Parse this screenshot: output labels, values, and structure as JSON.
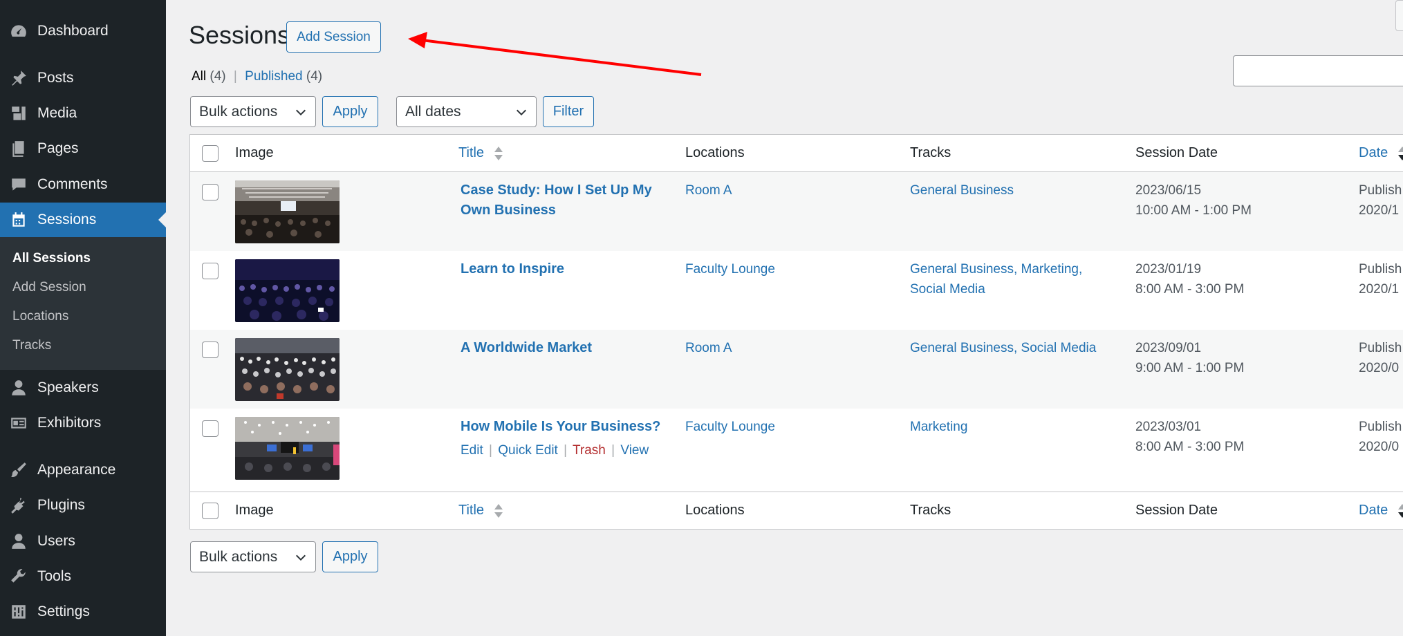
{
  "colors": {
    "sidebar_bg": "#1d2327",
    "accent": "#2271b1",
    "arrow": "#ff0000",
    "trash": "#b32d2e"
  },
  "sidebar": {
    "items": [
      {
        "label": "Dashboard",
        "icon": "dashboard-icon"
      },
      {
        "label": "Posts",
        "icon": "pushpin-icon"
      },
      {
        "label": "Media",
        "icon": "media-icon"
      },
      {
        "label": "Pages",
        "icon": "pages-icon"
      },
      {
        "label": "Comments",
        "icon": "comment-icon"
      },
      {
        "label": "Sessions",
        "icon": "calendar-icon",
        "current": true
      },
      {
        "label": "Speakers",
        "icon": "user-icon"
      },
      {
        "label": "Exhibitors",
        "icon": "id-card-icon"
      },
      {
        "label": "Appearance",
        "icon": "brush-icon"
      },
      {
        "label": "Plugins",
        "icon": "plug-icon"
      },
      {
        "label": "Users",
        "icon": "user-icon"
      },
      {
        "label": "Tools",
        "icon": "wrench-icon"
      },
      {
        "label": "Settings",
        "icon": "sliders-icon"
      }
    ],
    "submenu": [
      "All Sessions",
      "Add Session",
      "Locations",
      "Tracks"
    ]
  },
  "header": {
    "title": "Sessions",
    "add_button": "Add Session"
  },
  "views": {
    "all_label": "All",
    "all_count": "(4)",
    "separator": "|",
    "published_label": "Published",
    "published_count": "(4)"
  },
  "toolbar": {
    "bulk_actions": "Bulk actions",
    "apply": "Apply",
    "dates": "All dates",
    "filter": "Filter"
  },
  "table": {
    "columns": [
      "Image",
      "Title",
      "Locations",
      "Tracks",
      "Session Date",
      "Date"
    ],
    "rows": [
      {
        "title_line1": "Case Study: How I Set Up My",
        "title_line2": "Own Business",
        "location": "Room A",
        "tracks_line1": "General Business",
        "tracks_line2": "",
        "session_date": "2023/06/15",
        "session_time": "10:00 AM - 1:00 PM",
        "status": "Publish",
        "date": "2020/1"
      },
      {
        "title_line1": "Learn to Inspire",
        "title_line2": "",
        "location": "Faculty Lounge",
        "tracks_line1": "General Business, Marketing,",
        "tracks_line2": "Social Media",
        "session_date": "2023/01/19",
        "session_time": "8:00 AM - 3:00 PM",
        "status": "Publish",
        "date": "2020/1"
      },
      {
        "title_line1": "A Worldwide Market",
        "title_line2": "",
        "location": "Room A",
        "tracks_line1": "General Business, Social Media",
        "tracks_line2": "",
        "session_date": "2023/09/01",
        "session_time": "9:00 AM - 1:00 PM",
        "status": "Publish",
        "date": "2020/0"
      },
      {
        "title_line1": "How Mobile Is Your Business?",
        "title_line2": "",
        "location": "Faculty Lounge",
        "tracks_line1": "Marketing",
        "tracks_line2": "",
        "session_date": "2023/03/01",
        "session_time": "8:00 AM - 3:00 PM",
        "status": "Publish",
        "date": "2020/0"
      }
    ],
    "row_actions": {
      "edit": "Edit",
      "quick_edit": "Quick Edit",
      "trash": "Trash",
      "view": "View",
      "sep": "|"
    }
  }
}
